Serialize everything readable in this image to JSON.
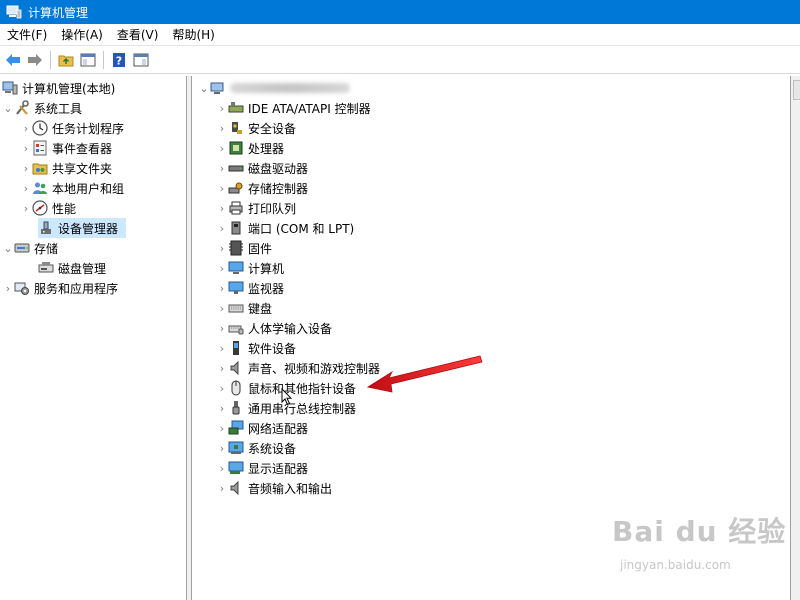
{
  "titlebar": {
    "title": "计算机管理"
  },
  "menu": {
    "items": [
      "文件(F)",
      "操作(A)",
      "查看(V)",
      "帮助(H)"
    ]
  },
  "left_tree": {
    "root": "计算机管理(本地)",
    "system_tools": "系统工具",
    "task_scheduler": "任务计划程序",
    "event_viewer": "事件查看器",
    "shared_folders": "共享文件夹",
    "local_users": "本地用户和组",
    "performance": "性能",
    "device_manager": "设备管理器",
    "storage": "存储",
    "disk_management": "磁盘管理",
    "services_apps": "服务和应用程序"
  },
  "devices": [
    {
      "label": "IDE ATA/ATAPI 控制器",
      "icon": "ide-controller-icon"
    },
    {
      "label": "安全设备",
      "icon": "security-device-icon"
    },
    {
      "label": "处理器",
      "icon": "processor-icon"
    },
    {
      "label": "磁盘驱动器",
      "icon": "disk-drive-icon"
    },
    {
      "label": "存储控制器",
      "icon": "storage-controller-icon"
    },
    {
      "label": "打印队列",
      "icon": "printer-icon"
    },
    {
      "label": "端口 (COM 和 LPT)",
      "icon": "port-icon"
    },
    {
      "label": "固件",
      "icon": "firmware-icon"
    },
    {
      "label": "计算机",
      "icon": "computer-icon"
    },
    {
      "label": "监视器",
      "icon": "monitor-icon"
    },
    {
      "label": "键盘",
      "icon": "keyboard-icon"
    },
    {
      "label": "人体学输入设备",
      "icon": "hid-icon"
    },
    {
      "label": "软件设备",
      "icon": "software-device-icon"
    },
    {
      "label": "声音、视频和游戏控制器",
      "icon": "sound-icon"
    },
    {
      "label": "鼠标和其他指针设备",
      "icon": "mouse-icon"
    },
    {
      "label": "通用串行总线控制器",
      "icon": "usb-icon"
    },
    {
      "label": "网络适配器",
      "icon": "network-adapter-icon"
    },
    {
      "label": "系统设备",
      "icon": "system-device-icon"
    },
    {
      "label": "显示适配器",
      "icon": "display-adapter-icon"
    },
    {
      "label": "音频输入和输出",
      "icon": "audio-io-icon"
    }
  ],
  "watermark": {
    "main": "Bai du 经验",
    "sub": "jingyan.baidu.com"
  },
  "colors": {
    "titlebar": "#0078d7",
    "selection": "#cce8ff",
    "arrow": "#e8141c"
  }
}
